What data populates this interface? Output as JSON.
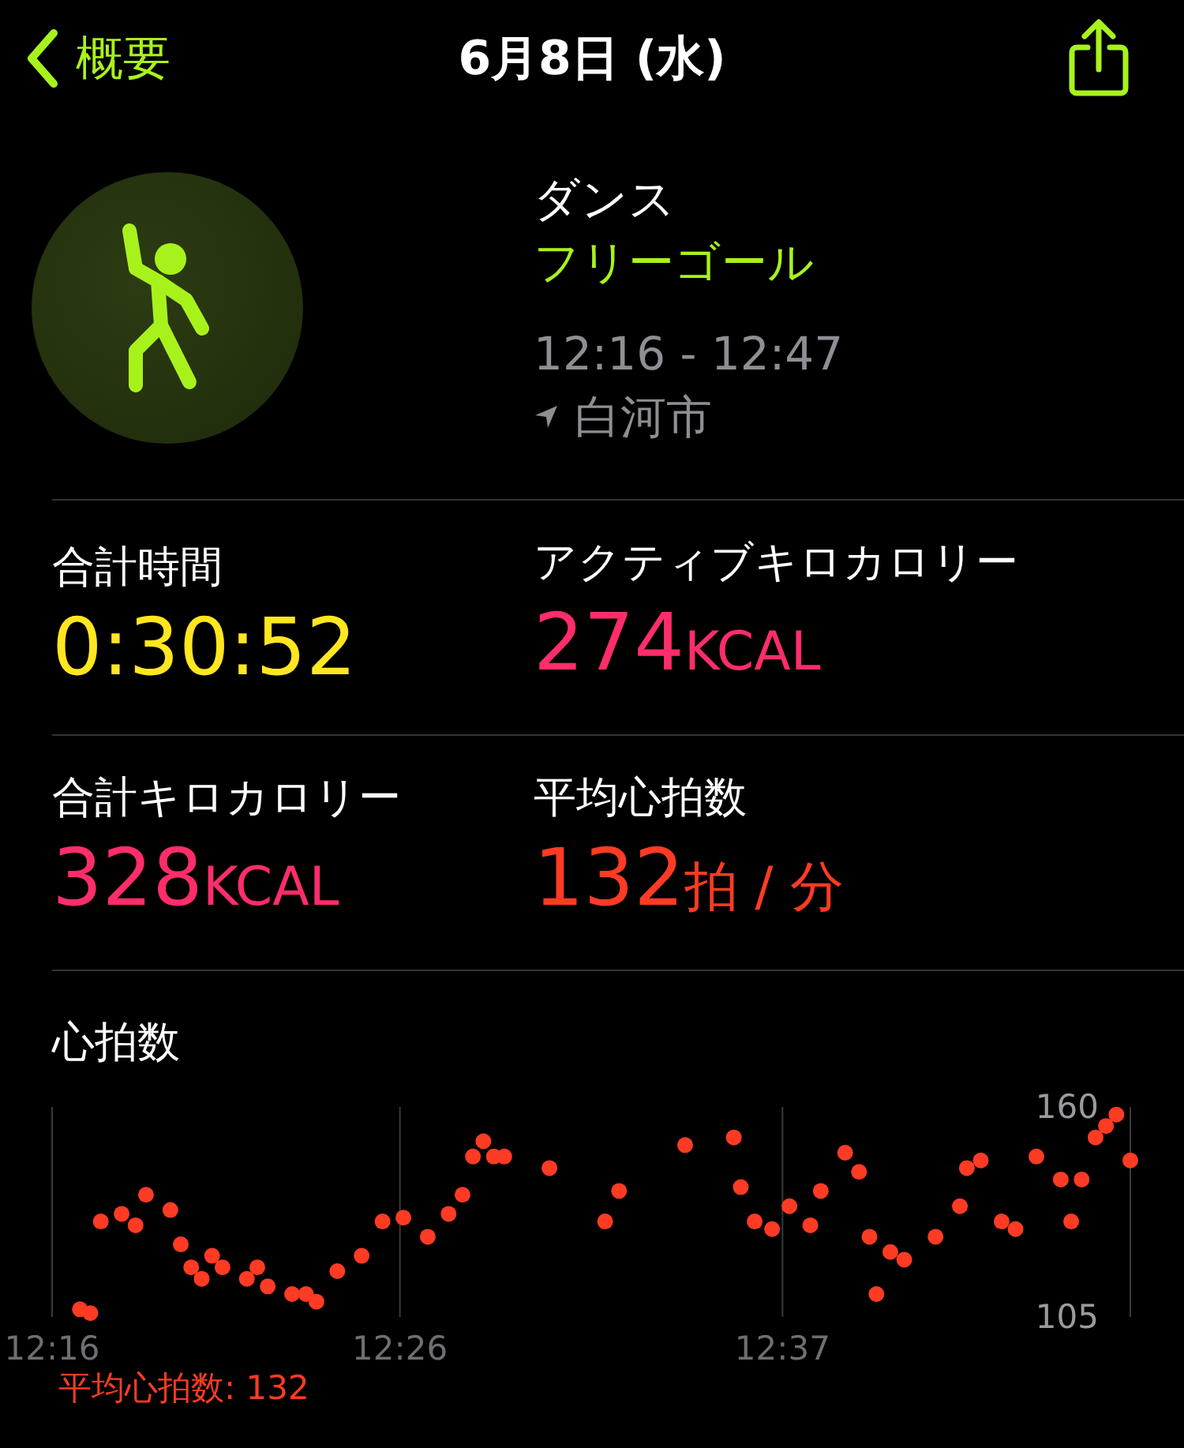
{
  "nav": {
    "back_label": "概要",
    "title": "6月8日 (水)"
  },
  "workout": {
    "type": "ダンス",
    "goal": "フリーゴール",
    "time_range": "12:16 - 12:47",
    "location": "白河市"
  },
  "metrics": [
    {
      "label": "合計時間",
      "value": "0:30:52",
      "color": "#ffe620"
    },
    {
      "label": "アクティブキロカロリー",
      "value": "274",
      "unit": "KCAL",
      "color": "#ff2d6a"
    },
    {
      "label": "合計キロカロリー",
      "value": "328",
      "unit": "KCAL",
      "color": "#ff2d6a"
    },
    {
      "label": "平均心拍数",
      "value": "132",
      "unit": "拍 / 分",
      "color": "#ff3b24"
    }
  ],
  "heart_rate": {
    "title": "心拍数",
    "average_label": "平均心拍数: 132",
    "chart_data": {
      "type": "scatter",
      "xlim": [
        736,
        767
      ],
      "ylim": [
        105,
        160
      ],
      "yticks": [
        105,
        160
      ],
      "xticks": [
        {
          "value": 736,
          "label": "12:16"
        },
        {
          "value": 746,
          "label": "12:26"
        },
        {
          "value": 757,
          "label": "12:37"
        }
      ],
      "series": [
        {
          "color": "#ff3b24",
          "x": [
            736.8,
            737.1,
            737.4,
            738.0,
            738.4,
            738.7,
            739.4,
            739.7,
            740.0,
            740.3,
            740.6,
            740.9,
            741.6,
            741.9,
            742.2,
            742.9,
            743.3,
            743.6,
            744.2,
            744.9,
            745.5,
            746.1,
            746.8,
            747.4,
            747.8,
            748.1,
            748.4,
            748.7,
            749.0,
            750.3,
            751.9,
            752.3,
            754.2,
            755.6,
            755.8,
            756.2,
            756.7,
            757.2,
            757.8,
            758.1,
            758.8,
            759.2,
            759.5,
            759.7,
            760.1,
            760.5,
            761.4,
            762.1,
            762.3,
            762.7,
            763.3,
            763.7,
            764.3,
            765.0,
            765.3,
            765.6,
            766.0,
            766.3,
            766.6,
            767.0
          ],
          "values": [
            107,
            106,
            130,
            132,
            129,
            137,
            133,
            124,
            118,
            115,
            121,
            118,
            115,
            118,
            113,
            111,
            111,
            109,
            117,
            121,
            130,
            131,
            126,
            132,
            137,
            147,
            151,
            147,
            147,
            144,
            130,
            138,
            150,
            152,
            139,
            130,
            128,
            134,
            129,
            138,
            148,
            143,
            126,
            111,
            122,
            120,
            126,
            134,
            144,
            146,
            130,
            128,
            147,
            141,
            130,
            141,
            152,
            155,
            158,
            146
          ]
        }
      ]
    }
  }
}
